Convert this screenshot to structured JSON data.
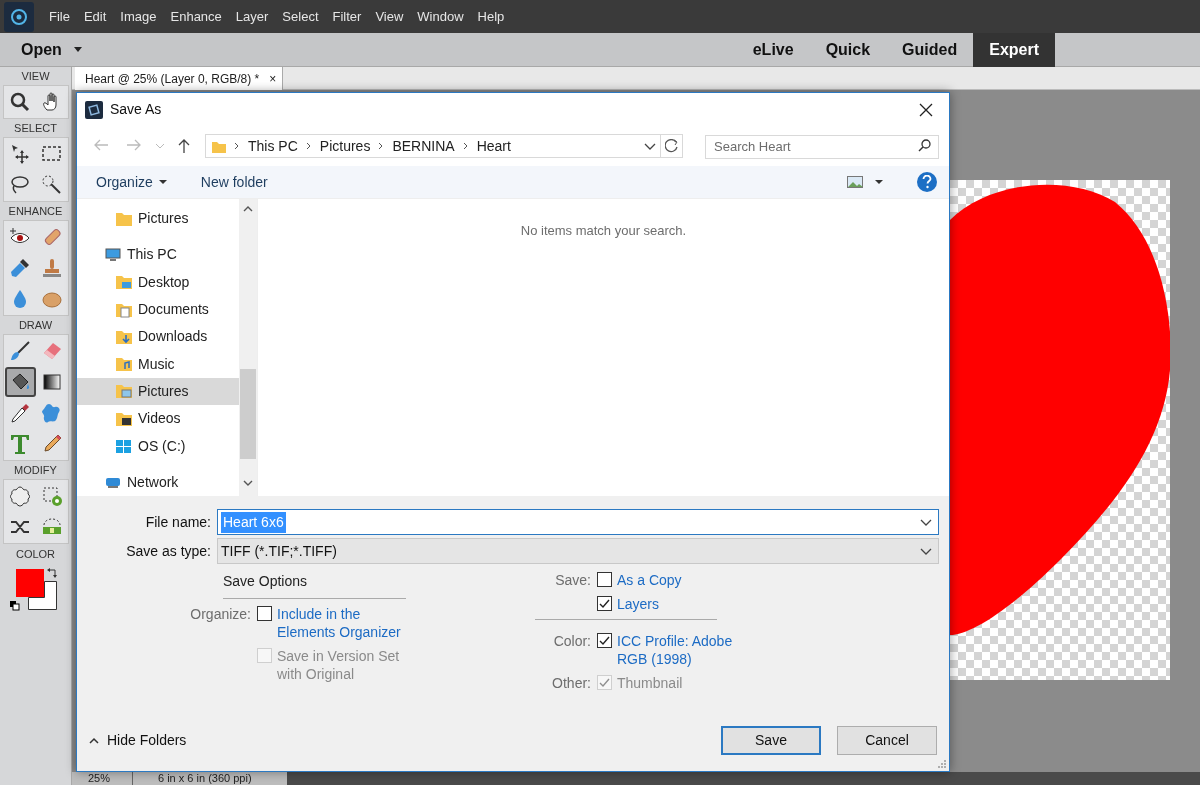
{
  "menu_bar": {
    "items": [
      "File",
      "Edit",
      "Image",
      "Enhance",
      "Layer",
      "Select",
      "Filter",
      "View",
      "Window",
      "Help"
    ]
  },
  "mode_bar": {
    "open_label": "Open",
    "modes": [
      {
        "label": "eLive",
        "selected": false
      },
      {
        "label": "Quick",
        "selected": false
      },
      {
        "label": "Guided",
        "selected": false
      },
      {
        "label": "Expert",
        "selected": true
      }
    ]
  },
  "tools_panel": {
    "sections": [
      {
        "label": "VIEW",
        "tools": [
          {
            "kind": "zoom",
            "selected": false
          },
          {
            "kind": "hand",
            "selected": false
          }
        ]
      },
      {
        "label": "SELECT",
        "tools": [
          {
            "kind": "move",
            "selected": false
          },
          {
            "kind": "marquee",
            "selected": false
          },
          {
            "kind": "lasso",
            "selected": false
          },
          {
            "kind": "wand",
            "selected": false
          }
        ]
      },
      {
        "label": "ENHANCE",
        "tools": [
          {
            "kind": "eye",
            "selected": false
          },
          {
            "kind": "bandage",
            "selected": false
          },
          {
            "kind": "smudge",
            "selected": false
          },
          {
            "kind": "stamp",
            "selected": false
          },
          {
            "kind": "drop",
            "selected": false
          },
          {
            "kind": "sponge",
            "selected": false
          }
        ]
      },
      {
        "label": "DRAW",
        "tools": [
          {
            "kind": "brush",
            "selected": false
          },
          {
            "kind": "eraser",
            "selected": false
          },
          {
            "kind": "bucket",
            "selected": true
          },
          {
            "kind": "gradient",
            "selected": false
          },
          {
            "kind": "dropper",
            "selected": false
          },
          {
            "kind": "shape",
            "selected": false
          },
          {
            "kind": "type",
            "selected": false
          },
          {
            "kind": "pencil",
            "selected": false
          }
        ]
      },
      {
        "label": "MODIFY",
        "tools": [
          {
            "kind": "cookie",
            "selected": false
          },
          {
            "kind": "crop",
            "selected": false
          },
          {
            "kind": "recompose",
            "selected": false
          },
          {
            "kind": "straighten",
            "selected": false
          }
        ]
      }
    ],
    "color_label": "COLOR",
    "swatches": [
      {
        "kind": "background",
        "color": "#ffffff"
      },
      {
        "kind": "foreground",
        "color": "#ff0000"
      }
    ]
  },
  "document_tab": {
    "title": "Heart @ 25% (Layer 0, RGB/8) *",
    "close": "×"
  },
  "status_bar": {
    "zoom": "25%",
    "size": "6 in x 6 in (360 ppi)"
  },
  "dialog": {
    "title": "Save As",
    "breadcrumb": [
      "This PC",
      "Pictures",
      "BERNINA",
      "Heart"
    ],
    "search": {
      "placeholder": "Search Heart"
    },
    "toolbar": {
      "organize": "Organize",
      "new_folder": "New folder"
    },
    "tree": [
      {
        "label": "Pictures",
        "kind": "folder",
        "selected": false
      },
      {
        "label": "This PC",
        "kind": "pc",
        "selected": false,
        "children": [
          {
            "label": "Desktop",
            "kind": "desktop",
            "selected": false
          },
          {
            "label": "Documents",
            "kind": "documents",
            "selected": false
          },
          {
            "label": "Downloads",
            "kind": "downloads",
            "selected": false
          },
          {
            "label": "Music",
            "kind": "music",
            "selected": false
          },
          {
            "label": "Pictures",
            "kind": "pictures",
            "selected": true
          },
          {
            "label": "Videos",
            "kind": "videos",
            "selected": false
          },
          {
            "label": "OS (C:)",
            "kind": "drive",
            "selected": false
          }
        ]
      },
      {
        "label": "Network",
        "kind": "network",
        "selected": false
      }
    ],
    "empty_message": "No items match your search.",
    "file_name": {
      "label": "File name:",
      "value": "Heart 6x6"
    },
    "save_as_type": {
      "label": "Save as type:",
      "value": "TIFF (*.TIF;*.TIFF)"
    },
    "save_options": {
      "title": "Save Options",
      "left": [
        {
          "label": "Organize:",
          "text": "Include in the Elements Organizer",
          "checked": false,
          "disabled": false
        },
        {
          "text": "Save in Version Set with Original",
          "checked": false,
          "disabled": true
        }
      ],
      "right": [
        {
          "label": "Save:",
          "text": "As a Copy",
          "checked": false,
          "disabled": false
        },
        {
          "text": "Layers",
          "checked": true,
          "disabled": false
        },
        {
          "label": "Color:",
          "text": "ICC Profile:  Adobe RGB (1998)",
          "checked": true,
          "disabled": false
        },
        {
          "label": "Other:",
          "text": "Thumbnail",
          "checked": true,
          "disabled": true
        }
      ]
    },
    "hide_folders": "Hide Folders",
    "buttons": [
      {
        "label": "Save",
        "kind": "primary"
      },
      {
        "label": "Cancel",
        "kind": "normal"
      }
    ]
  }
}
